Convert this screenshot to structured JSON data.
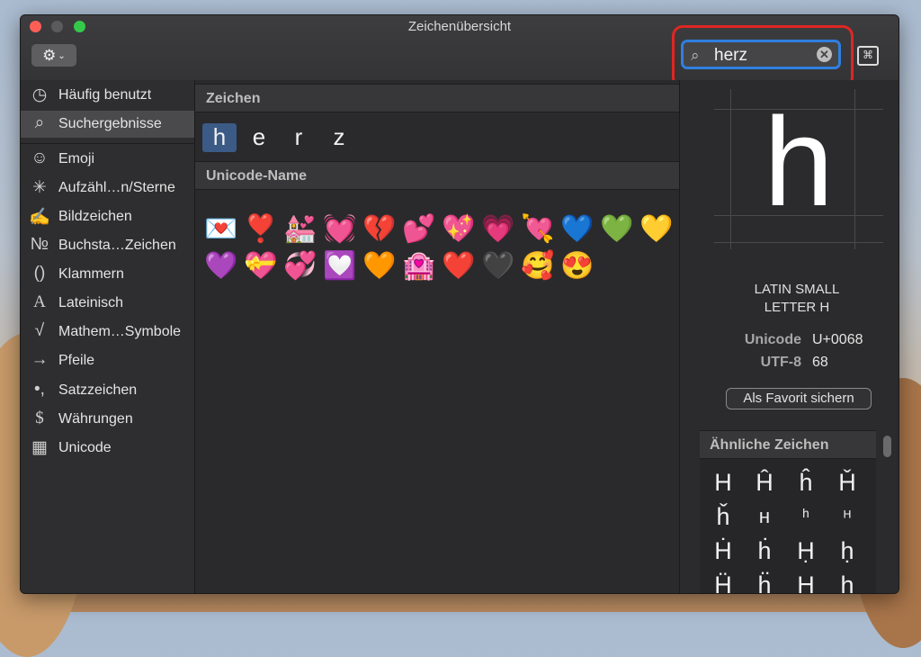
{
  "window": {
    "title": "Zeichenübersicht"
  },
  "toolbar": {
    "gear_icon": "⚙",
    "gear_chevron": "⌄",
    "search_value": "herz",
    "search_icon": "⌕",
    "clear_icon": "✕",
    "grid_icon": "⌘"
  },
  "sidebar": {
    "items": [
      {
        "icon": "◷",
        "label": "Häufig benutzt"
      },
      {
        "icon": "⌕",
        "label": "Suchergebnisse"
      },
      {
        "icon": "☺",
        "label": "Emoji"
      },
      {
        "icon": "✳",
        "label": "Aufzähl…n/Sterne"
      },
      {
        "icon": "✍",
        "label": "Bildzeichen"
      },
      {
        "icon": "№",
        "label": "Buchsta…Zeichen"
      },
      {
        "icon": "()",
        "label": "Klammern"
      },
      {
        "icon": "A",
        "label": "Lateinisch"
      },
      {
        "icon": "√",
        "label": "Mathem…Symbole"
      },
      {
        "icon": "→",
        "label": "Pfeile"
      },
      {
        "icon": "•,",
        "label": "Satzzeichen"
      },
      {
        "icon": "$",
        "label": "Währungen"
      },
      {
        "icon": "▦",
        "label": "Unicode"
      }
    ]
  },
  "main": {
    "chars_header": "Zeichen",
    "chars": [
      "h",
      "e",
      "r",
      "z"
    ],
    "unicode_header": "Unicode-Name",
    "emojis": [
      "💌",
      "❣️",
      "💒",
      "💓",
      "💔",
      "💕",
      "💖",
      "💗",
      "💘",
      "💙",
      "💚",
      "💛",
      "💜",
      "💝",
      "💞",
      "💟",
      "🧡",
      "🏩",
      "❤️",
      "🖤",
      "🥰",
      "😍"
    ]
  },
  "detail": {
    "glyph": "h",
    "name_line1": "LATIN SMALL",
    "name_line2": "LETTER H",
    "unicode_label": "Unicode",
    "unicode_value": "U+0068",
    "utf8_label": "UTF-8",
    "utf8_value": "68",
    "favorite_label": "Als Favorit sichern",
    "similar_header": "Ähnliche Zeichen",
    "similar": [
      "H",
      "Ĥ",
      "ĥ",
      "Ȟ",
      "ȟ",
      "ʜ",
      "ʰ",
      "ᴴ",
      "Ḣ",
      "ḣ",
      "Ḥ",
      "ḥ",
      "Ḧ",
      "ḧ",
      "Ḩ",
      "ḩ"
    ]
  }
}
